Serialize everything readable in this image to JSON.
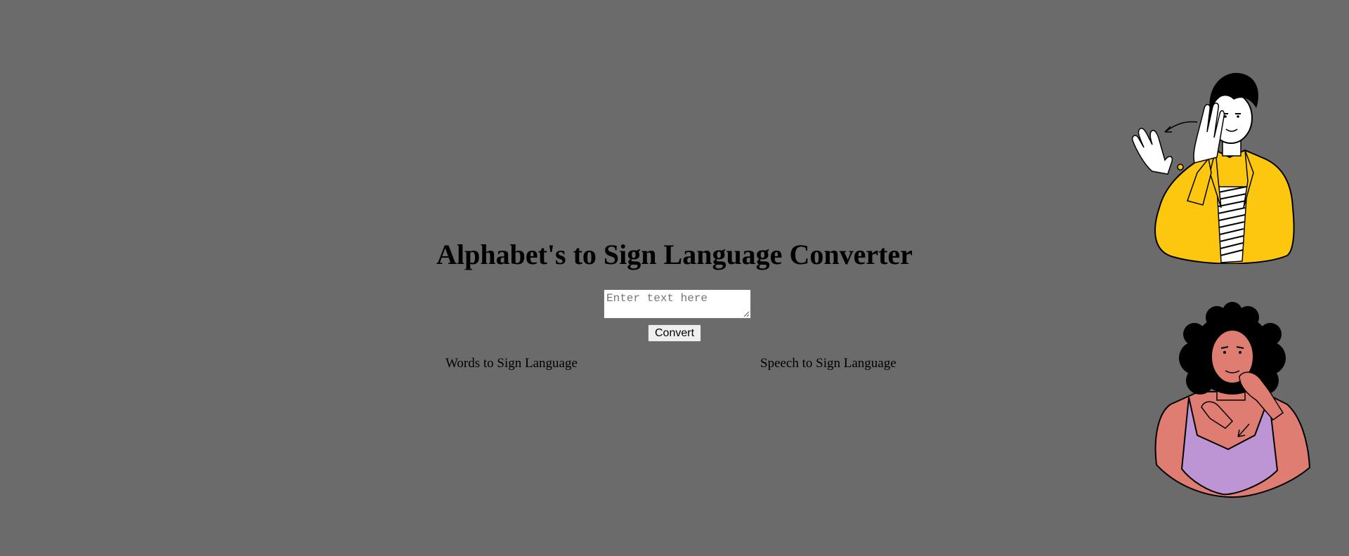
{
  "header": {
    "title": "Alphabet's to Sign Language Converter"
  },
  "converter": {
    "input_placeholder": "Enter text here",
    "input_value": "",
    "convert_label": "Convert"
  },
  "nav": {
    "words_label": "Words to Sign Language",
    "speech_label": "Speech to Sign Language"
  },
  "illustrations": {
    "top": "man-signing-hello-illustration",
    "bottom": "woman-signing-illustration"
  },
  "colors": {
    "background": "#6b6b6b",
    "jacket": "#fcc70e",
    "top": "#bd95d4",
    "skin": "#e07d73"
  }
}
